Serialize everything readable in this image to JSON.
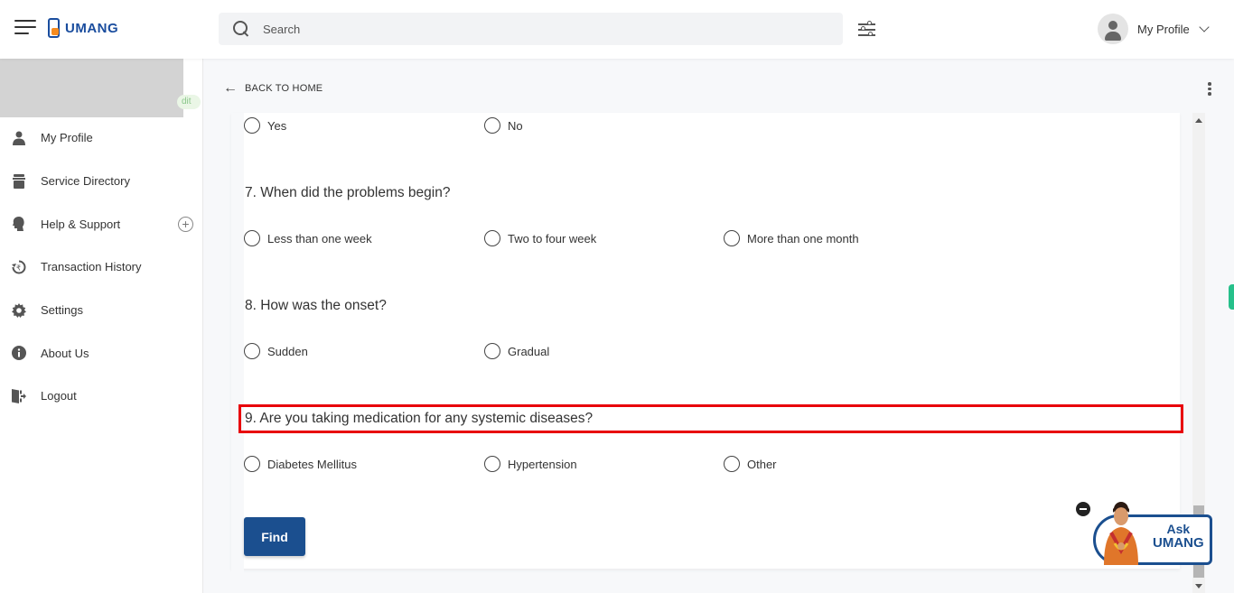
{
  "header": {
    "app_name": "UMANG",
    "search_placeholder": "Search",
    "profile_label": "My Profile"
  },
  "sidebar": {
    "edit_label": "dit",
    "items": [
      {
        "label": "My Profile",
        "icon": "person-icon"
      },
      {
        "label": "Service Directory",
        "icon": "directory-icon"
      },
      {
        "label": "Help & Support",
        "icon": "help-head-icon"
      },
      {
        "label": "Transaction History",
        "icon": "history-icon"
      },
      {
        "label": "Settings",
        "icon": "gear-icon"
      },
      {
        "label": "About Us",
        "icon": "info-icon"
      },
      {
        "label": "Logout",
        "icon": "logout-icon"
      }
    ]
  },
  "main": {
    "back_label": "BACK TO HOME",
    "prev_options": [
      "Yes",
      "No"
    ],
    "questions": [
      {
        "text": "7. When did the problems begin?",
        "options": [
          "Less than one week",
          "Two to four week",
          "More than one month"
        ]
      },
      {
        "text": "8. How was the onset?",
        "options": [
          "Sudden",
          "Gradual"
        ]
      },
      {
        "text": "9. Are you taking medication for any systemic diseases?",
        "options": [
          "Diabetes Mellitus",
          "Hypertension",
          "Other"
        ]
      }
    ],
    "find_label": "Find"
  },
  "assistant": {
    "line1": "Ask",
    "line2": "UMANG"
  },
  "colors": {
    "brand": "#1b4f8f",
    "highlight": "#e8000b",
    "accent_orange": "#f68b1f",
    "side_tab": "#26c08a"
  }
}
